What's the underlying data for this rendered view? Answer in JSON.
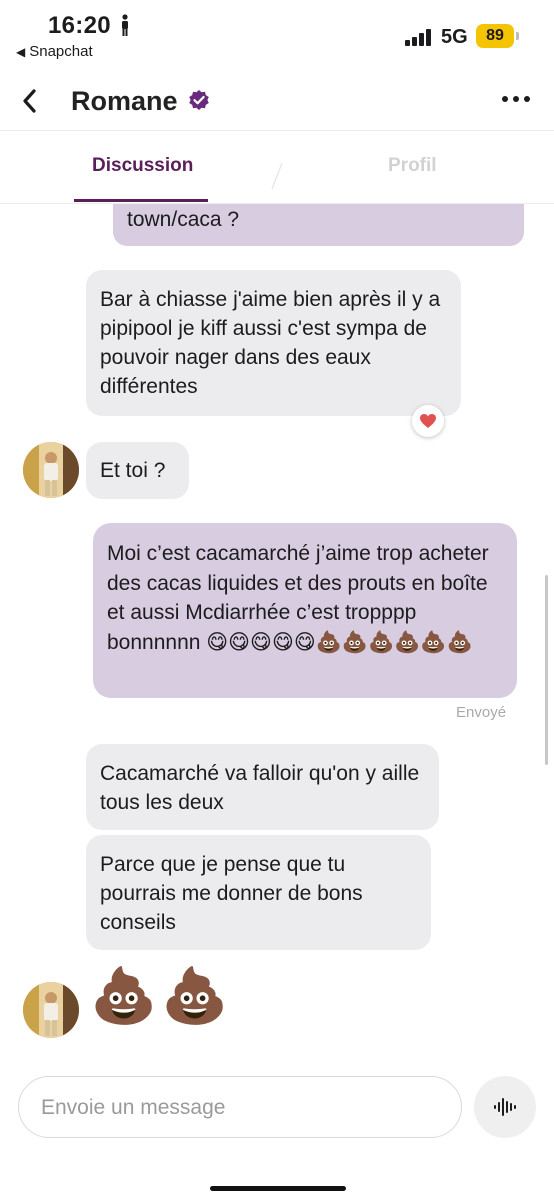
{
  "status_bar": {
    "time": "16:20",
    "back_app_label": "Snapchat",
    "network": "5G",
    "battery": "89",
    "battery_color": "#f5c400"
  },
  "header": {
    "back_icon": "chevron-left-icon",
    "contact_name": "Romane",
    "verified_icon": "verified-badge-icon",
    "more_icon": "more-dots-icon"
  },
  "tabs": {
    "active": "Discussion",
    "inactive": "Profil",
    "accent_color": "#5a1f5a"
  },
  "messages": [
    {
      "sender": "me",
      "text": "town/caca ?"
    },
    {
      "sender": "Romane",
      "text": "Bar à chiasse j'aime bien après il y a pipipool je kiff aussi c'est sympa de pouvoir nager dans des eaux différentes",
      "reaction": "heart"
    },
    {
      "sender": "Romane",
      "text": "Et toi ?"
    },
    {
      "sender": "me",
      "text": "Moi c’est cacamarché j’aime trop acheter des cacas liquides et des prouts en boîte et aussi Mcdiarrhée c’est tropppp bonnnnnn 😋😋😋😋😋💩💩💩💩💩💩"
    },
    {
      "sender": "Romane",
      "text": "Cacamarché va falloir qu'on y aille tous les deux"
    },
    {
      "sender": "Romane",
      "text": "Parce que je pense que tu pourrais me donner de bons conseils"
    },
    {
      "sender": "Romane",
      "text": "💩💩"
    }
  ],
  "delivery_status": "Envoyé",
  "composer": {
    "placeholder": "Envoie un message",
    "voice_icon": "voice-wave-icon"
  },
  "colors": {
    "sent_bubble": "#d8cce0",
    "received_bubble": "#ececee",
    "heart": "#e0524f"
  }
}
